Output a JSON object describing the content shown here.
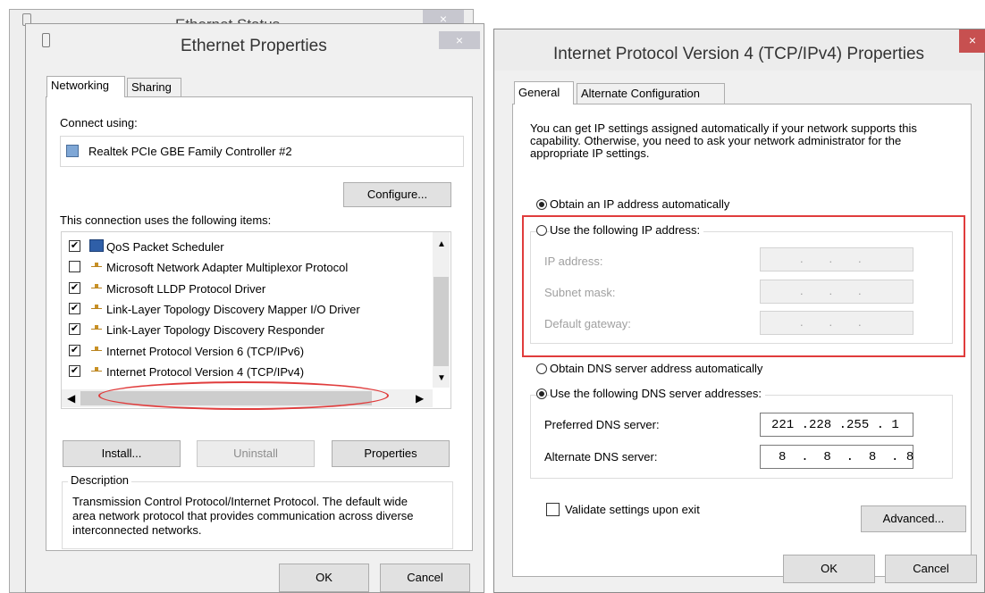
{
  "back_window": {
    "title": "Ethernet Status",
    "close_label": "×"
  },
  "ethernet_props": {
    "title": "Ethernet Properties",
    "close_label": "×",
    "tabs": [
      "Networking",
      "Sharing"
    ],
    "connect_using_label": "Connect using:",
    "adapter_name": "Realtek PCIe GBE Family Controller #2",
    "configure_label": "Configure...",
    "items_label": "This connection uses the following items:",
    "items": [
      {
        "label": "QoS Packet Scheduler",
        "checked": true,
        "icon": "qos-scheduler-icon"
      },
      {
        "label": "Microsoft Network Adapter Multiplexor Protocol",
        "checked": false,
        "icon": "network-protocol-icon"
      },
      {
        "label": "Microsoft LLDP Protocol Driver",
        "checked": true,
        "icon": "network-protocol-icon"
      },
      {
        "label": "Link-Layer Topology Discovery Mapper I/O Driver",
        "checked": true,
        "icon": "network-protocol-icon"
      },
      {
        "label": "Link-Layer Topology Discovery Responder",
        "checked": true,
        "icon": "network-protocol-icon"
      },
      {
        "label": "Internet Protocol Version 6 (TCP/IPv6)",
        "checked": true,
        "icon": "network-protocol-icon"
      },
      {
        "label": "Internet Protocol Version 4 (TCP/IPv4)",
        "checked": true,
        "icon": "network-protocol-icon"
      }
    ],
    "install_label": "Install...",
    "uninstall_label": "Uninstall",
    "properties_label": "Properties",
    "description_label": "Description",
    "description_text": "Transmission Control Protocol/Internet Protocol. The default wide area network protocol that provides communication across diverse interconnected networks.",
    "ok_label": "OK",
    "cancel_label": "Cancel"
  },
  "ipv4_props": {
    "title": "Internet Protocol Version 4 (TCP/IPv4) Properties",
    "close_label": "×",
    "tabs": [
      "General",
      "Alternate Configuration"
    ],
    "intro_text": "You can get IP settings assigned automatically if your network supports this capability. Otherwise, you need to ask your network administrator for the appropriate IP settings.",
    "obtain_ip_auto": "Obtain an IP address automatically",
    "use_following_ip": "Use the following IP address:",
    "ip_address_label": "IP address:",
    "subnet_mask_label": "Subnet mask:",
    "default_gateway_label": "Default gateway:",
    "empty_ip": ".        .        .",
    "obtain_dns_auto": "Obtain DNS server address automatically",
    "use_following_dns": "Use the following DNS server addresses:",
    "preferred_dns_label": "Preferred DNS server:",
    "preferred_dns_value": "221 .228 .255 . 1",
    "alternate_dns_label": "Alternate DNS server:",
    "alternate_dns_value": "8  .  8  .  8  . 8",
    "validate_label": "Validate settings upon exit",
    "advanced_label": "Advanced...",
    "ok_label": "OK",
    "cancel_label": "Cancel"
  },
  "colors": {
    "highlight_red": "#e03c3c",
    "close_red": "#c75050"
  }
}
